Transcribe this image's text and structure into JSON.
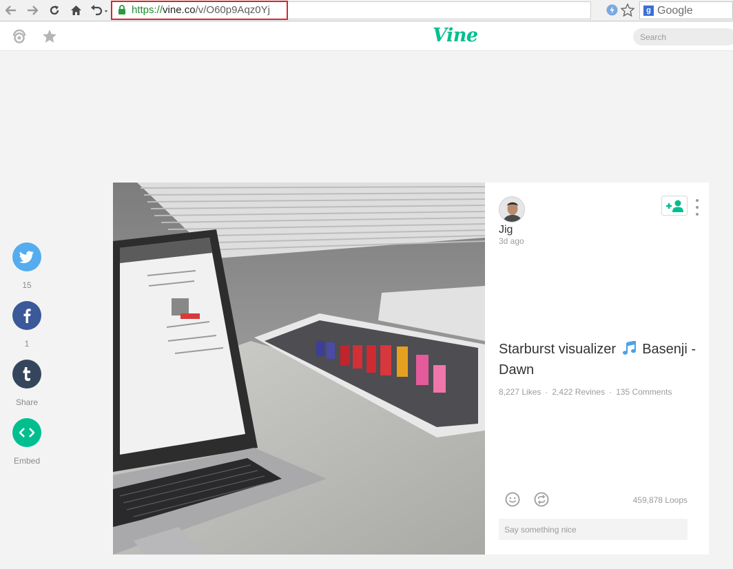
{
  "browser": {
    "url_scheme": "https://",
    "url_host": "vine.co",
    "url_path": "/v/O60p9Aqz0Yj",
    "search_engine_label": "Google"
  },
  "header": {
    "logo": "Vine",
    "search_placeholder": "Search"
  },
  "share": {
    "twitter_count": "15",
    "facebook_count": "1",
    "tumblr_label": "Share",
    "embed_label": "Embed",
    "colors": {
      "twitter": "#55acee",
      "facebook": "#3b5998",
      "tumblr": "#35465c",
      "embed": "#00bf8f"
    }
  },
  "post": {
    "username": "Jig",
    "timestamp": "3d ago",
    "caption_before": "Starburst visualizer",
    "caption_after": "Basenji - Dawn",
    "likes": "8,227 Likes",
    "revines": "2,422 Revines",
    "comments": "135 Comments",
    "loops": "459,878 Loops",
    "comment_placeholder": "Say something nice"
  },
  "icons": {
    "follow": "add-user-icon",
    "more": "more-vertical-icon",
    "smile": "smile-icon",
    "revine": "revine-icon",
    "music": "music-note-icon"
  },
  "colors": {
    "accent": "#00bf8f",
    "highlight": "#d9242a",
    "music_note": "#4aa3e8"
  }
}
